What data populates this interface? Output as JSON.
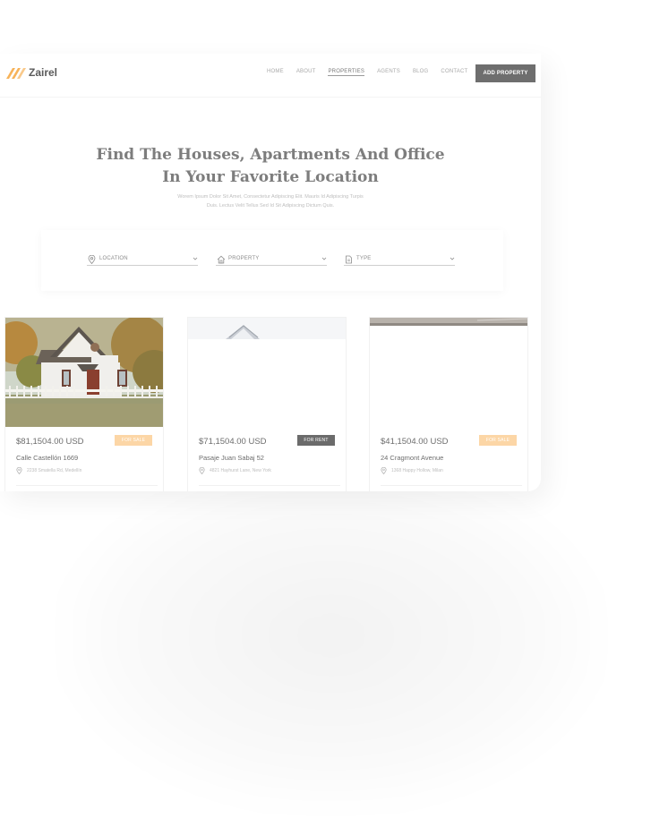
{
  "brand": {
    "name": "Zairel",
    "accent": "#f7b35a"
  },
  "nav": {
    "items": [
      "HOME",
      "ABOUT",
      "PROPERTIES",
      "AGENTS",
      "BLOG",
      "CONTACT"
    ],
    "active": "PROPERTIES",
    "cta": "ADD PROPERTY"
  },
  "hero": {
    "title_line1": "Find The Houses, Apartments And Office",
    "title_line2": "In Your Favorite Location",
    "subtitle_line1": "Worem Ipsum Dolor Sit Amet, Consectetur Adipiscing Elit. Mauris Id Adipiscing Turpis",
    "subtitle_line2": "Duis. Lectus Velit Tellus Sed Id Sit Adipiscing Dictum Quis."
  },
  "search": {
    "location_label": "LOCATION",
    "location_icon": "pin-icon",
    "property_label": "PROPERTY",
    "property_icon": "home-icon",
    "type_label": "TYPE",
    "type_icon": "document-icon"
  },
  "listings": [
    {
      "price": "$81,1504.00 USD",
      "badge": "FOR SALE",
      "badge_kind": "sale",
      "name": "Calle Castellón 1669",
      "address": "2238 Smatella Rd, Medellín"
    },
    {
      "price": "$71,1504.00 USD",
      "badge": "FOR RENT",
      "badge_kind": "rent",
      "name": "Pasaje Juan Sabaj 52",
      "address": "4821 Hayhurst Lane, New York"
    },
    {
      "price": "$41,1504.00 USD",
      "badge": "FOR SALE",
      "badge_kind": "sale",
      "name": "24 Cragmont Avenue",
      "address": "1368 Happy Hollow, Milan"
    }
  ],
  "colors": {
    "sale_badge": "#fcd6a6",
    "rent_badge": "#6b6b6b",
    "cta_bg": "#6e6e6e"
  }
}
